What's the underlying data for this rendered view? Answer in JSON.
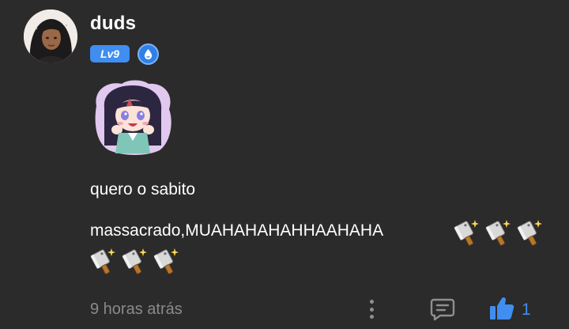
{
  "comment": {
    "author": {
      "username": "duds",
      "level_label": "Lv9",
      "avatar_icon": "user-avatar-portrait",
      "role_icon": "water-drop-shield-badge"
    },
    "sticker_icon": "anime-girl-sticker",
    "text_line_1": "quero o sabito",
    "text_line_2": "massacrado,MUAHAHAHAHHAAHAHA",
    "emoji_name": "cleaver-knife-sparkle",
    "emoji_count": 6,
    "timestamp": "9 horas atrás",
    "actions": {
      "more_icon": "vertical-dots",
      "reply_icon": "comment-bubble",
      "like_icon": "thumbs-up",
      "like_count": "1"
    }
  },
  "colors": {
    "background": "#2b2b2b",
    "accent": "#3f8ef0",
    "muted": "#8a8a8a"
  }
}
